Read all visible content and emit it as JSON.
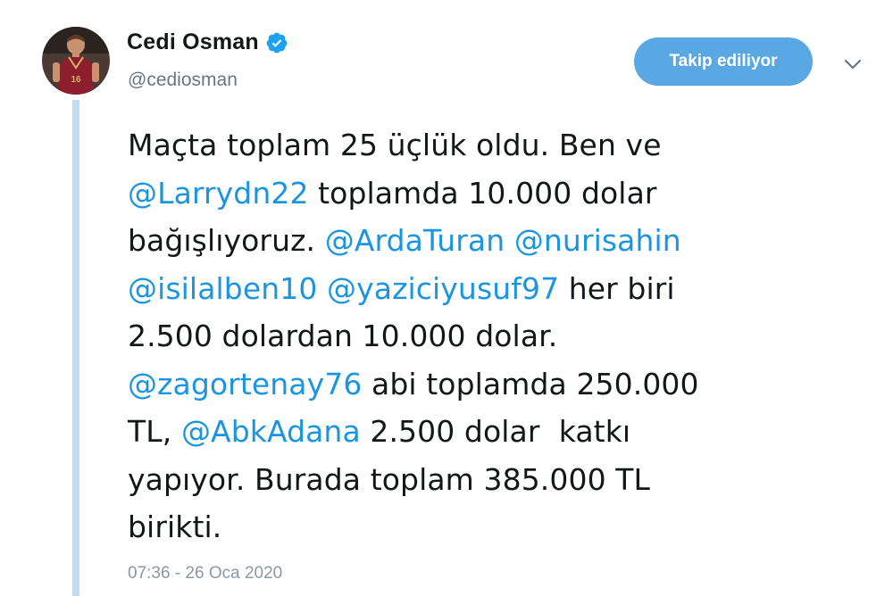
{
  "user": {
    "display_name": "Cedi Osman",
    "handle": "@cediosman",
    "verified": true,
    "avatar_icon": "player-avatar"
  },
  "follow_button": {
    "label": "Takip ediliyor"
  },
  "menu_icon": "chevron-down-icon",
  "tweet": {
    "lines": [
      [
        {
          "text": "Maçta toplam 25 üçlük oldu. Ben ve"
        }
      ],
      [
        {
          "text": "@Larrydn22",
          "mention": true
        },
        {
          "text": " toplamda 10.000 dolar"
        }
      ],
      [
        {
          "text": "bağışlıyoruz. "
        },
        {
          "text": "@ArdaTuran",
          "mention": true
        },
        {
          "text": " "
        },
        {
          "text": "@nurisahin",
          "mention": true
        }
      ],
      [
        {
          "text": "@isilalben10",
          "mention": true
        },
        {
          "text": " "
        },
        {
          "text": "@yaziciyusuf97",
          "mention": true
        },
        {
          "text": " her biri"
        }
      ],
      [
        {
          "text": "2.500 dolardan 10.000 dolar."
        }
      ],
      [
        {
          "text": "@zagortenay76",
          "mention": true
        },
        {
          "text": " abi toplamda 250.000"
        }
      ],
      [
        {
          "text": "TL, "
        },
        {
          "text": "@AbkAdana",
          "mention": true
        },
        {
          "text": " 2.500 dolar  katkı"
        }
      ],
      [
        {
          "text": "yapıyor. Burada toplam 385.000 TL"
        }
      ],
      [
        {
          "text": "birikti."
        }
      ]
    ],
    "timestamp": "07:36 - 26 Oca 2020"
  },
  "colors": {
    "mention": "#1b95e0",
    "follow_button_bg": "#5aa8e3",
    "thread_line": "#c2dcef",
    "verified": "#1da1f2",
    "muted": "#657786"
  }
}
